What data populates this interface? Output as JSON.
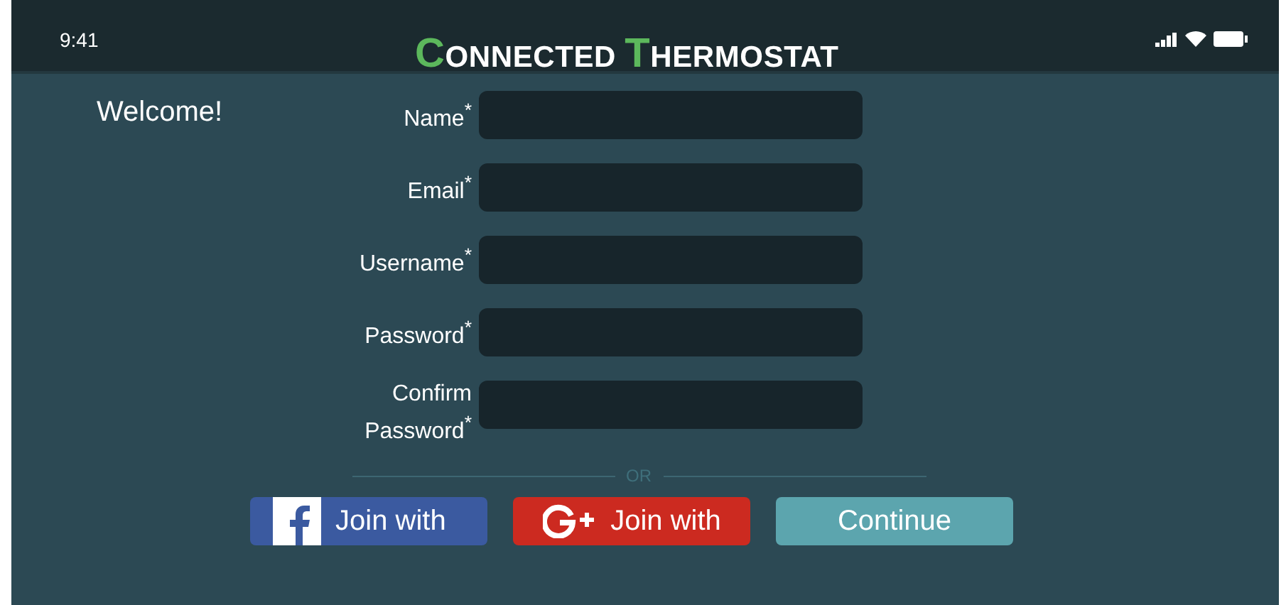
{
  "status_bar": {
    "time": "9:41"
  },
  "header": {
    "title": "CONNECTED THERMOSTAT"
  },
  "welcome": "Welcome!",
  "form": {
    "fields": [
      {
        "label": "Name$^{*}$"
      },
      {
        "label": "Email$^{*}$"
      },
      {
        "label": "Username$^{*}$"
      },
      {
        "label": "Password$^{*}$"
      },
      {
        "label": "Confirm Password$^{*}$"
      }
    ],
    "divider": "OR",
    "buttons": [
      {
        "kind": "facebook",
        "label": "Join with"
      },
      {
        "kind": "google",
        "label": "Join with"
      },
      {
        "kind": "continue",
        "label": "Continue"
      }
    ]
  }
}
